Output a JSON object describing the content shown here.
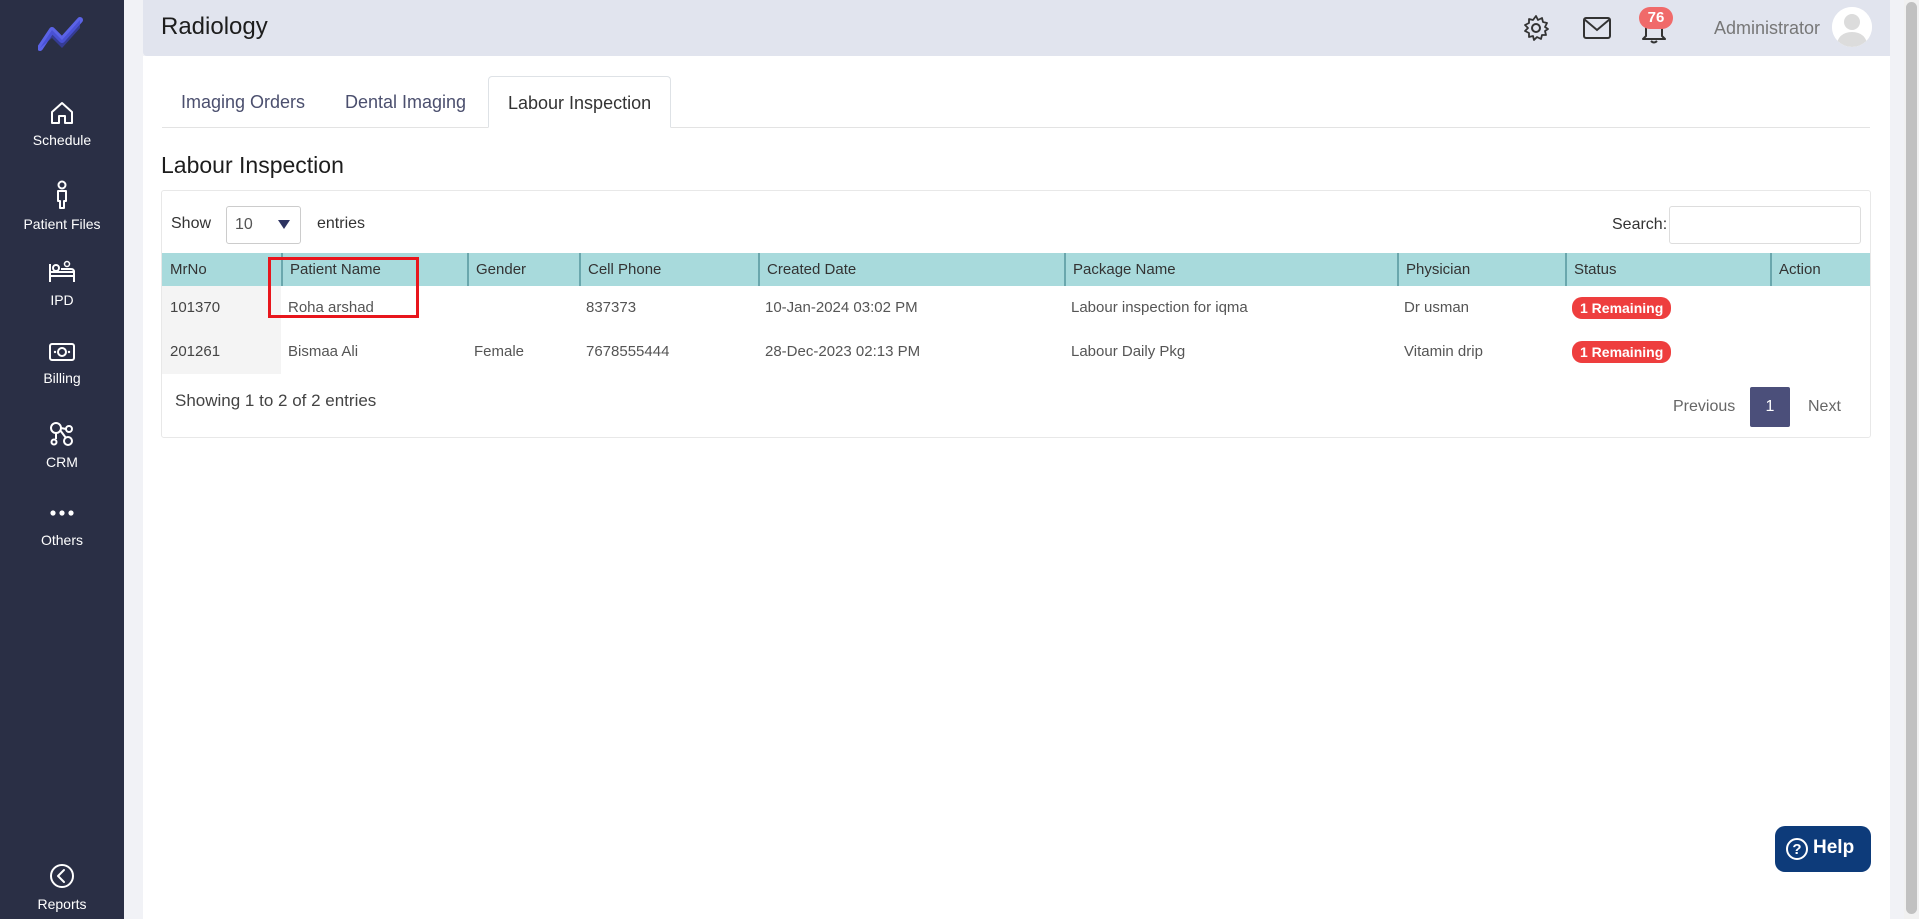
{
  "sidebar": {
    "logo": "trend-line-logo",
    "items": [
      {
        "label": "Schedule",
        "icon": "home-icon"
      },
      {
        "label": "Patient Files",
        "icon": "patient-icon"
      },
      {
        "label": "IPD",
        "icon": "bed-icon"
      },
      {
        "label": "Billing",
        "icon": "money-icon"
      },
      {
        "label": "CRM",
        "icon": "network-icon"
      },
      {
        "label": "Others",
        "icon": "more-dots-icon"
      }
    ],
    "reports": {
      "label": "Reports",
      "icon": "back-circle-icon"
    }
  },
  "header": {
    "title": "Radiology",
    "notification_count": "76",
    "user_name": "Administrator"
  },
  "tabs": [
    {
      "label": "Imaging Orders",
      "active": false
    },
    {
      "label": "Dental Imaging",
      "active": false
    },
    {
      "label": "Labour Inspection",
      "active": true
    }
  ],
  "section_title": "Labour Inspection",
  "controls": {
    "show_label": "Show",
    "entries_value": "10",
    "entries_label": "entries",
    "search_label": "Search:",
    "search_value": ""
  },
  "table": {
    "columns": [
      "MrNo",
      "Patient Name",
      "Gender",
      "Cell Phone",
      "Created Date",
      "Package Name",
      "Physician",
      "Status",
      "Action"
    ],
    "rows": [
      {
        "mrno": "101370",
        "patient": "Roha arshad",
        "gender": "",
        "phone": "837373",
        "created": "10-Jan-2024 03:02 PM",
        "package": "Labour inspection for iqma",
        "physician": "Dr usman",
        "status": "1 Remaining",
        "action": ""
      },
      {
        "mrno": "201261",
        "patient": "Bismaa Ali",
        "gender": "Female",
        "phone": "7678555444",
        "created": "28-Dec-2023 02:13 PM",
        "package": "Labour Daily Pkg",
        "physician": "Vitamin drip",
        "status": "1 Remaining",
        "action": ""
      }
    ]
  },
  "footer": {
    "showing": "Showing 1 to 2 of 2 entries",
    "previous": "Previous",
    "current_page": "1",
    "next": "Next"
  },
  "help": {
    "label": "Help",
    "icon_glyph": "?"
  },
  "colors": {
    "sidebar_bg": "#2a2f45",
    "table_header": "#a8dadc",
    "status_red": "#ee3e3e",
    "pagination_active": "#4b4f7a",
    "help_bg": "#0d3b7a"
  }
}
